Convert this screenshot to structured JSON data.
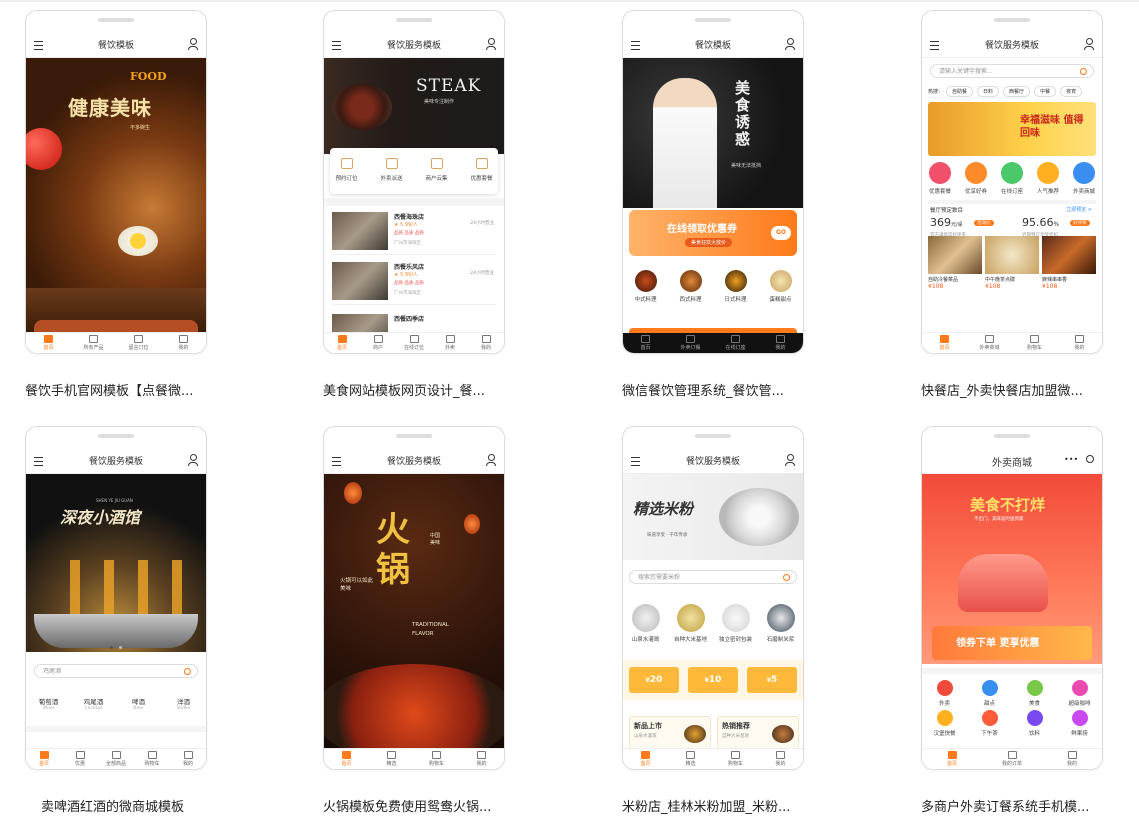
{
  "cards": [
    {
      "title": "餐饮模板",
      "caption": "餐饮手机官网模板【点餐微...",
      "hero_text": {
        "brand": "FOOD",
        "slogan": "健康美味",
        "sub": "不多碗生"
      },
      "tabs": [
        "首页",
        "所有产品",
        "留言订位",
        "我的"
      ]
    },
    {
      "title": "餐饮服务模板",
      "caption": "美食网站模板网页设计_餐...",
      "hero_text": {
        "brand": "STEAK",
        "sub": "美味专注制作"
      },
      "icons": [
        "预约订位",
        "外卖派送",
        "商户云集",
        "优惠套餐"
      ],
      "stores": [
        {
          "name": "西餐海珠店",
          "meta": "★ 5  99/人",
          "tags": "品质 品质 品质",
          "addr": "广州市海珠区",
          "right": "24小时营业"
        },
        {
          "name": "西餐乐风店",
          "meta": "★ 5  99/人",
          "tags": "品质 品质 品质",
          "addr": "广州市海珠区",
          "right": "24小时营业"
        },
        {
          "name": "西餐四季店",
          "meta": "",
          "tags": "",
          "addr": "",
          "right": ""
        }
      ],
      "tabs": [
        "首页",
        "商户",
        "在线订位",
        "外卖",
        "我的"
      ]
    },
    {
      "title": "餐饮模板",
      "caption": "微信餐饮管理系统_餐饮管...",
      "hero_text": {
        "slogan": "美食诱惑",
        "sub": "美味无法抵挡"
      },
      "banner": "在线领取优惠券",
      "banner_sub": "美食狂欢大放价",
      "banner_btn": "GO",
      "categories": [
        "中式料理",
        "西式料理",
        "日式料理",
        "蛋糕甜点"
      ],
      "tabs": [
        "首页",
        "外卖订餐",
        "在线订座",
        "我的"
      ]
    },
    {
      "title": "餐饮服务模板",
      "caption": "快餐店_外卖快餐店加盟微...",
      "search_placeholder": "请输入关键字搜索...",
      "hot_label": "热搜：",
      "hot_tags": [
        "自助餐",
        "日料",
        "西餐厅",
        "中餐",
        "夜宵"
      ],
      "banner": "幸福滋味 值得回味",
      "icons": [
        "优惠套餐",
        "优享好券",
        "在线订座",
        "人气推荐",
        "外卖商城"
      ],
      "stats": {
        "label": "餐厅预定数目",
        "link": "立即预定 >",
        "v1": "369",
        "v1_unit": "元/桌",
        "v1_badge": "活动价",
        "v1_note": "官方满意度好评率",
        "v2": "95.66",
        "v2_unit": "%",
        "v2_badge": "好评率",
        "v2_note": "近期预订享受折扣"
      },
      "foods": [
        {
          "name": "自助冷餐菜品",
          "price": "¥108"
        },
        {
          "name": "中午晚茶点碟",
          "price": "¥108"
        },
        {
          "name": "麻辣串串香",
          "price": "¥108"
        }
      ],
      "tabs": [
        "首页",
        "外卖商城",
        "购物车",
        "我的"
      ]
    },
    {
      "title": "餐饮服务模板",
      "caption": "卖啤酒红酒的微商城模板",
      "hero_text": {
        "slogan": "深夜小酒馆",
        "sub": "SHEN YE JIU GUAN"
      },
      "search_placeholder": "鸡尾酒",
      "drinks": [
        {
          "cn": "葡萄酒",
          "en": "Wine"
        },
        {
          "cn": "鸡尾酒",
          "en": "Cocktail"
        },
        {
          "cn": "啤酒",
          "en": "Beer"
        },
        {
          "cn": "洋酒",
          "en": "Vodka"
        }
      ],
      "tabs": [
        "首页",
        "优惠",
        "全部商品",
        "购物车",
        "我的"
      ]
    },
    {
      "title": "餐饮服务模板",
      "caption": "火锅模板免费使用鸳鸯火锅...",
      "hero_text": {
        "slogan": "火锅",
        "side1": "中国美味",
        "side2": "火锅可以如此美味",
        "en1": "TRADITIONAL",
        "en2": "FLAVOR"
      },
      "tabs": [
        "首页",
        "精选",
        "购物车",
        "我的"
      ]
    },
    {
      "title": "餐饮服务模板",
      "caption": "米粉店_桂林米粉加盟_米粉...",
      "hero_text": {
        "slogan": "精选米粉",
        "sub": "味道享受 · 千年传承"
      },
      "search_placeholder": "搜索您需要米粉",
      "icons": [
        "山泉水灌溉",
        "自种大米基地",
        "独立密封包装",
        "石磨制米浆"
      ],
      "coupons": [
        "20",
        "10",
        "5"
      ],
      "promos": [
        {
          "title": "新品上市",
          "sub": "山泉水灌溉"
        },
        {
          "title": "热销推荐",
          "sub": "自种大米基地"
        }
      ],
      "tabs": [
        "首页",
        "精选",
        "购物车",
        "我的"
      ]
    },
    {
      "title": "外卖商城",
      "caption": "多商户外卖订餐系统手机模...",
      "hero_text": {
        "slogan": "美食不打烊",
        "sub": "不出门，美味准时送到家"
      },
      "banner": "领券下单 更享优惠",
      "icons_row1": [
        "外卖",
        "甜点",
        "美食",
        "超级咖啡"
      ],
      "icons_row2": [
        "汉堡快餐",
        "下午茶",
        "饮料",
        "鲜果捞"
      ],
      "tabs": [
        "首页",
        "我的订单",
        "我的"
      ]
    }
  ],
  "colors": {
    "accent": "#ff7a1a",
    "coupon": "#ffb93a",
    "red_brand": "#f23c2e"
  }
}
